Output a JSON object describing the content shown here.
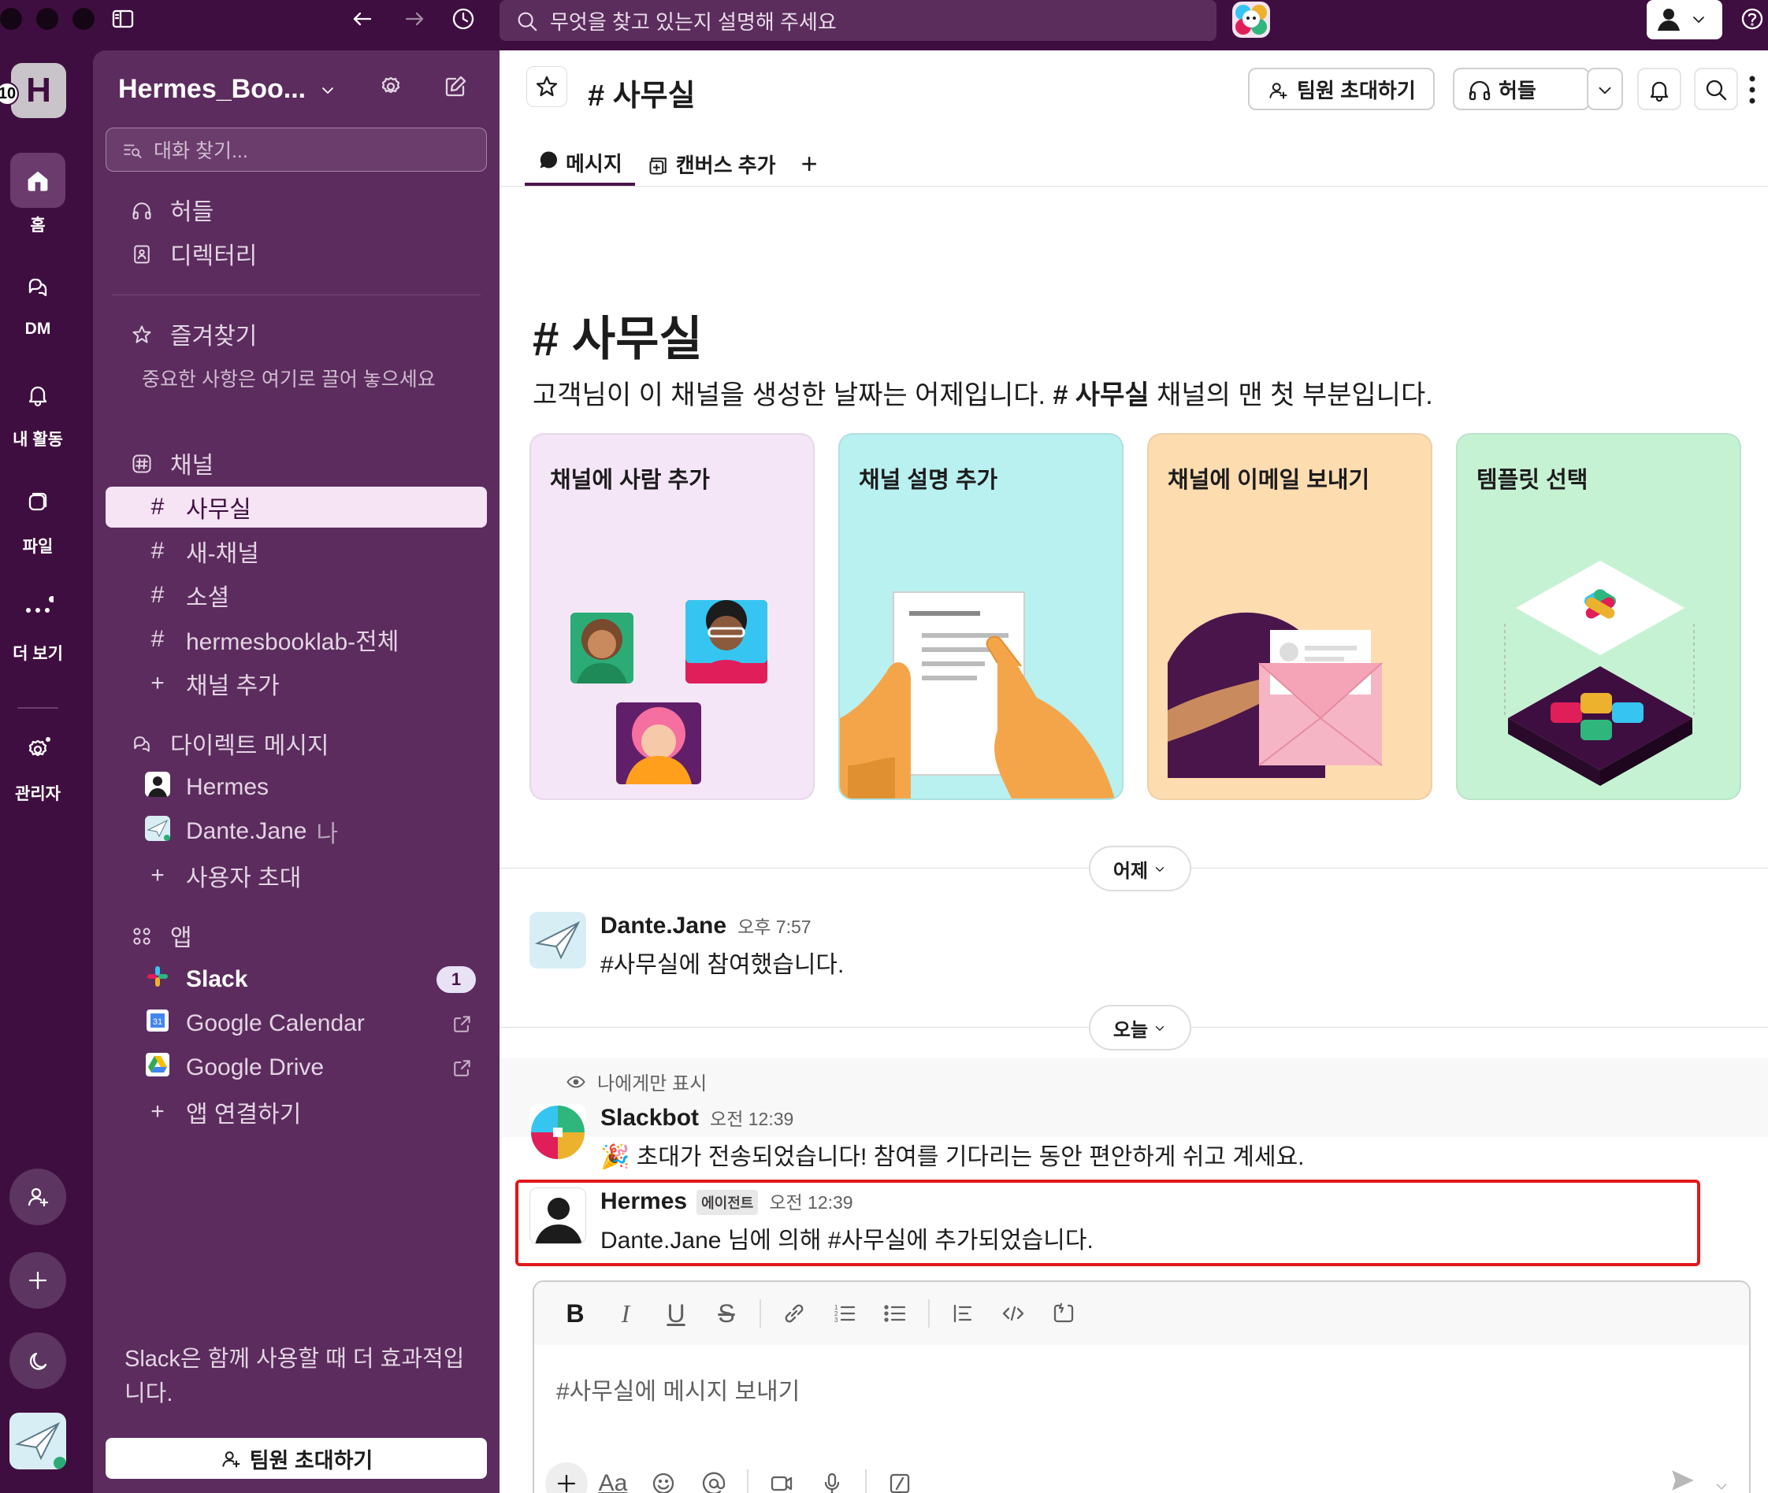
{
  "search": {
    "placeholder": "무엇을 찾고 있는지 설명해 주세요"
  },
  "rail": {
    "workspace_initial": "H",
    "workspace_count": "10",
    "items": [
      {
        "label": "홈",
        "icon": "home-icon"
      },
      {
        "label": "DM",
        "icon": "dm-icon"
      },
      {
        "label": "내 활동",
        "icon": "bell-icon"
      },
      {
        "label": "파일",
        "icon": "files-icon"
      },
      {
        "label": "더 보기",
        "icon": "more-icon"
      },
      {
        "label": "관리자",
        "icon": "admin-gear-icon"
      }
    ]
  },
  "sidebar": {
    "workspace_name": "Hermes_Boo...",
    "find_placeholder": "대화 찾기...",
    "huddle": "허들",
    "directory": "디렉터리",
    "favorites": "즐겨찾기",
    "favorites_hint": "중요한 사항은 여기로 끌어 놓으세요",
    "channels_header": "채널",
    "channels": [
      "사무실",
      "새-채널",
      "소셜",
      "hermesbooklab-전체"
    ],
    "add_channel": "채널 추가",
    "dm_header": "다이렉트 메시지",
    "dms": [
      {
        "name": "Hermes",
        "suffix": ""
      },
      {
        "name": "Dante.Jane",
        "suffix": "나"
      }
    ],
    "invite_user": "사용자 초대",
    "apps_header": "앱",
    "apps": [
      {
        "name": "Slack",
        "badge": "1"
      },
      {
        "name": "Google Calendar"
      },
      {
        "name": "Google Drive"
      }
    ],
    "connect_app": "앱 연결하기",
    "promo": "Slack은 함께 사용할 때 더 효과적입니다.",
    "invite_button": "팀원 초대하기"
  },
  "main": {
    "channel": "# 사무실",
    "invite_button": "팀원 초대하기",
    "huddle_button": "허들",
    "tabs": [
      "메시지",
      "캔버스 추가"
    ],
    "intro_title": "# 사무실",
    "intro_pre": "고객님이 이 채널을 생성한 날짜는 어제입니다. ",
    "intro_bold": "# 사무실",
    "intro_post": " 채널의 맨 첫 부분입니다.",
    "cards": [
      "채널에 사람 추가",
      "채널 설명 추가",
      "채널에 이메일 보내기",
      "템플릿 선택"
    ],
    "day_yesterday": "어제",
    "day_today": "오늘",
    "messages": [
      {
        "name": "Dante.Jane",
        "time": "오후 7:57",
        "text": "#사무실에 참여했습니다."
      },
      {
        "ephemeral_note": "나에게만 표시",
        "name": "Slackbot",
        "time": "오전 12:39",
        "text": "🎉 초대가 전송되었습니다! 참여를 기다리는 동안 편안하게 쉬고 계세요."
      },
      {
        "name": "Hermes",
        "tag": "에이전트",
        "time": "오전 12:39",
        "text": "Dante.Jane 님에 의해 #사무실에 추가되었습니다."
      }
    ],
    "composer_placeholder": "#사무실에 메시지 보내기"
  },
  "colors": {
    "aubergine": "#3f0e40",
    "sidebar": "#5c2c5e",
    "highlight_box": "#e0171b"
  }
}
